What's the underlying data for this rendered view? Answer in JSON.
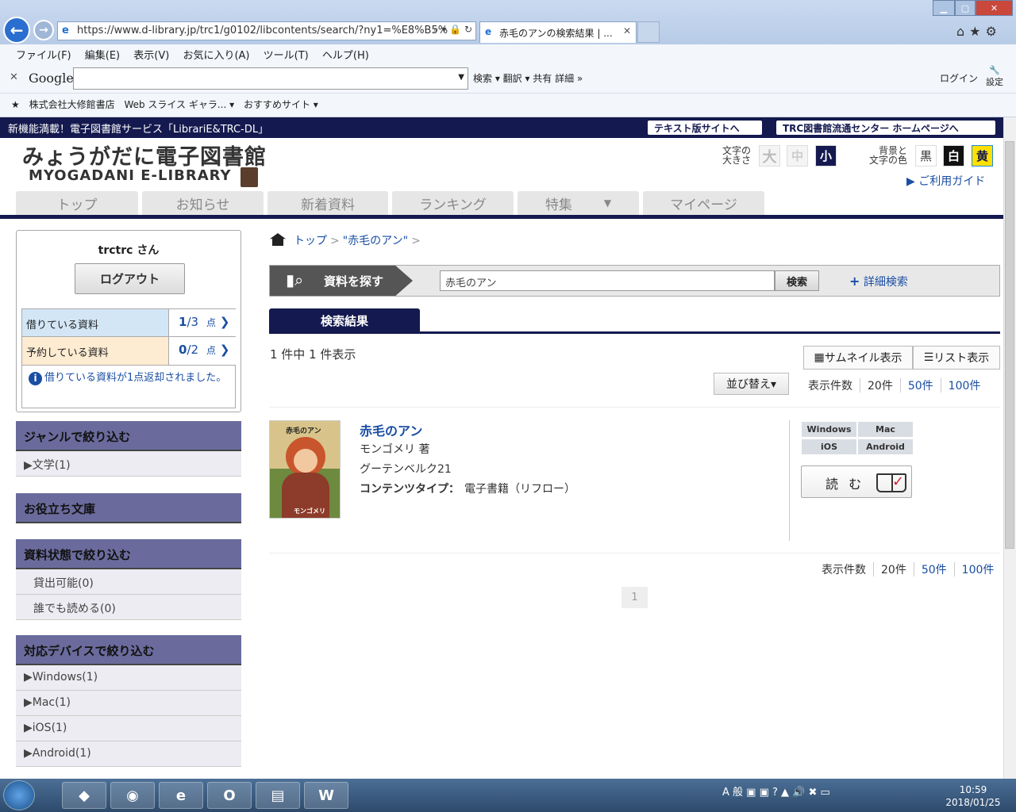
{
  "browser": {
    "url": "https://www.d-library.jp/trc1/g0102/libcontents/search/?ny1=%E8%B5%",
    "tab_title": "赤毛のアンの検索結果 | ...",
    "menu": [
      "ファイル(F)",
      "編集(E)",
      "表示(V)",
      "お気に入り(A)",
      "ツール(T)",
      "ヘルプ(H)"
    ],
    "google_logo": "Google",
    "google_tools": "検索 ▾   翻訳 ▾   共有   詳細 »",
    "login": "ログイン",
    "settings": "設定",
    "favorites": [
      "株式会社大修館書店",
      "Web スライス ギャラ... ▾",
      "おすすめサイト ▾"
    ]
  },
  "site": {
    "top_message": "新機能満載！電子図書館サービス「LibrariE&TRC-DL」",
    "text_site_link": "テキスト版サイトへ",
    "trc_link": "TRC図書館流通センター ホームページへ",
    "logo_jp": "みょうがだに電子図書館",
    "logo_en": "MYOGADANI E-LIBRARY",
    "font_size_label": "文字の\n大きさ",
    "font_sizes": [
      "大",
      "中",
      "小"
    ],
    "color_label": "背景と\n文字の色",
    "colors": [
      "黒",
      "白",
      "黄"
    ],
    "guide": "ご利用ガイド",
    "nav": [
      "トップ",
      "お知らせ",
      "新着資料",
      "ランキング",
      "特集",
      "マイページ"
    ]
  },
  "user": {
    "name": "trctrc さん",
    "logout": "ログアウト",
    "borrow_label": "借りている資料",
    "borrow_count": "1",
    "borrow_limit": "/3",
    "reserve_label": "予約している資料",
    "reserve_count": "0",
    "reserve_limit": "/2",
    "unit": "点",
    "notice": "借りている資料が1点返却されました。"
  },
  "filters": {
    "genre_head": "ジャンルで絞り込む",
    "genre_items": [
      "▶文学(1)"
    ],
    "bunko_head": "お役立ち文庫",
    "status_head": "資料状態で絞り込む",
    "status_items": [
      "貸出可能(0)",
      "誰でも読める(0)"
    ],
    "device_head": "対応デバイスで絞り込む",
    "device_items": [
      "▶Windows(1)",
      "▶Mac(1)",
      "▶iOS(1)",
      "▶Android(1)"
    ]
  },
  "main": {
    "breadcrumb": [
      "トップ",
      "\"赤毛のアン\""
    ],
    "search_label": "資料を探す",
    "search_value": "赤毛のアン",
    "search_button": "検索",
    "advanced": "詳細検索",
    "results_tab": "検索結果",
    "count_text": "1 件中 1 件表示",
    "thumb_view": "サムネイル表示",
    "list_view": "リスト表示",
    "sort": "並び替え▾",
    "per_page_label": "表示件数",
    "per_page": [
      "20件",
      "50件",
      "100件"
    ],
    "page": "1"
  },
  "book": {
    "cover_title": "赤毛のアン",
    "cover_author": "モンゴメリ",
    "title": "赤毛のアン",
    "author": "モンゴメリ 著",
    "publisher": "グーテンベルク21",
    "type_label": "コンテンツタイプ：",
    "type_value": "電子書籍（リフロー）",
    "devices": [
      "Windows",
      "Mac",
      "iOS",
      "Android"
    ],
    "read": "読 む"
  },
  "taskbar": {
    "clock_time": "10:59",
    "clock_date": "2018/01/25",
    "tray": "A 般"
  }
}
